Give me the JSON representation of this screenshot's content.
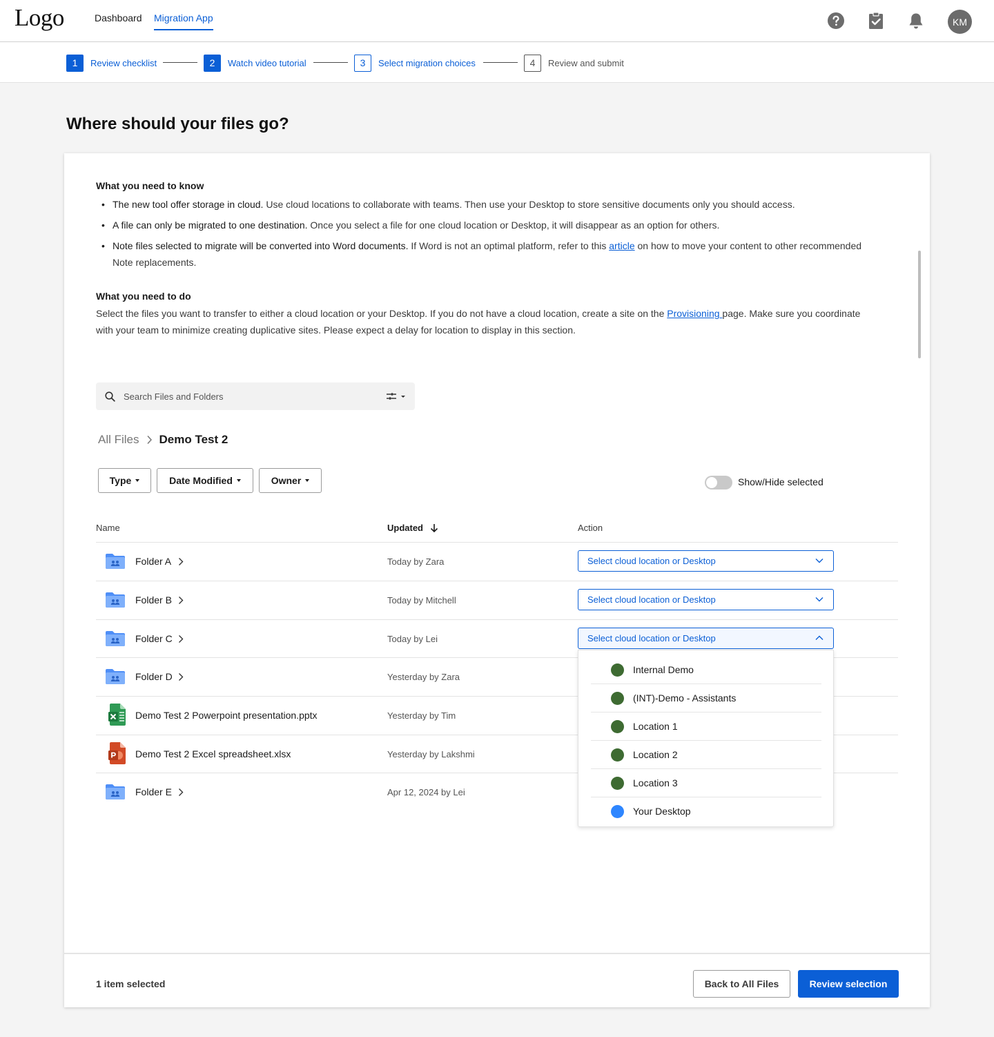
{
  "nav": {
    "logo": "Logo",
    "links": [
      {
        "label": "Dashboard",
        "active": false
      },
      {
        "label": "Migration App",
        "active": true
      }
    ],
    "icons": [
      "help-icon",
      "clipboard-check-icon",
      "bell-icon"
    ],
    "avatar_initials": "KM"
  },
  "stepper": {
    "steps": [
      {
        "num": "1",
        "label": "Review checklist",
        "state": "complete"
      },
      {
        "num": "2",
        "label": "Watch video tutorial",
        "state": "complete"
      },
      {
        "num": "3",
        "label": "Select migration choices",
        "state": "current"
      },
      {
        "num": "4",
        "label": "Review and submit",
        "state": "upcoming"
      }
    ]
  },
  "page_title": "Where should your files go?",
  "info": {
    "know_title": "What you need to know",
    "bullets": [
      {
        "bold": "The new tool offer storage in cloud.",
        "text": " Use cloud locations to collaborate with teams. Then use your Desktop to store sensitive documents only you should access."
      },
      {
        "bold": "A file can only be migrated to one destination.",
        "text": " Once you select a file for one cloud location or Desktop, it will disappear as an option for others."
      },
      {
        "bold": "Note files selected to migrate will be converted into Word documents.",
        "text_before_link": " If Word is not an optimal platform, refer to this ",
        "link": "article",
        "text_after_link": " on how to move your content to other recommended Note replacements."
      }
    ],
    "do_title": "What you need to do",
    "do_text_before_link": "Select the files you want to transfer to either a cloud location or your Desktop. If you do not have a cloud location, create a site on the ",
    "do_link": "Provisioning ",
    "do_text_after_link": "page. Make sure you coordinate with your team to minimize creating duplicative sites. Please expect a delay for location to display in this section."
  },
  "search": {
    "placeholder": "Search Files and Folders",
    "value": ""
  },
  "breadcrumb": {
    "root": "All Files",
    "current": "Demo Test 2"
  },
  "filters": [
    "Type",
    "Date Modified",
    "Owner"
  ],
  "toggle": {
    "label": "Show/Hide selected",
    "on": false
  },
  "table": {
    "columns": {
      "name": "Name",
      "updated": "Updated",
      "action": "Action"
    },
    "select_placeholder": "Select cloud location or Desktop",
    "rows": [
      {
        "name": "Folder A",
        "type": "folder",
        "updated": "Today by Zara",
        "has_action": true,
        "open": false
      },
      {
        "name": "Folder B",
        "type": "folder",
        "updated": "Today by Mitchell",
        "has_action": true,
        "open": false
      },
      {
        "name": "Folder C",
        "type": "folder",
        "updated": "Today by Lei",
        "has_action": true,
        "open": true
      },
      {
        "name": "Folder D",
        "type": "folder",
        "updated": "Yesterday by Zara",
        "has_action": false
      },
      {
        "name": "Demo Test 2 Powerpoint presentation.pptx",
        "type": "excel",
        "updated": "Yesterday by Tim",
        "has_action": false
      },
      {
        "name": "Demo Test 2 Excel spreadsheet.xlsx",
        "type": "powerpoint",
        "updated": "Yesterday by Lakshmi",
        "has_action": false
      },
      {
        "name": "Folder E",
        "type": "folder",
        "updated": "Apr 12, 2024 by Lei",
        "has_action": false
      }
    ]
  },
  "dropdown_options": [
    {
      "label": "Internal Demo",
      "color": "#3e6b32"
    },
    {
      "label": "(INT)-Demo - Assistants",
      "color": "#3e6b32"
    },
    {
      "label": "Location 1",
      "color": "#3e6b32"
    },
    {
      "label": "Location 2",
      "color": "#3e6b32"
    },
    {
      "label": "Location 3",
      "color": "#3e6b32"
    },
    {
      "label": "Your Desktop",
      "color": "#2e86ff"
    }
  ],
  "footer": {
    "selected_text": "1 item selected",
    "back_label": "Back to All Files",
    "review_label": "Review selection"
  },
  "colors": {
    "accent": "#0b5fd6",
    "location_dot": "#3e6b32",
    "desktop_dot": "#2e86ff"
  }
}
